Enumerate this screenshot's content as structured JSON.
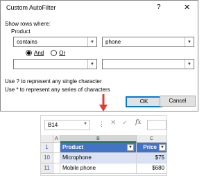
{
  "dialog": {
    "title": "Custom AutoFilter",
    "help_glyph": "?",
    "close_glyph": "✕",
    "show_rows_label": "Show rows where:",
    "field_label": "Product",
    "criteria1": {
      "operator": "contains",
      "value": "phone"
    },
    "criteria2": {
      "operator": "",
      "value": ""
    },
    "logic": {
      "and_label": "And",
      "or_label": "Or",
      "selected": "And"
    },
    "hint_single": "Use ? to represent any single character",
    "hint_series": "Use * to represent any series of characters",
    "ok_label": "OK",
    "cancel_label": "Cancel"
  },
  "arrow": {
    "color": "#e03c31"
  },
  "excel": {
    "name_box": "B14",
    "formula_bar_dots": "⋮",
    "cancel_glyph": "✕",
    "enter_glyph": "✓",
    "fx_label": "fx",
    "formula_value": "",
    "columns": [
      "A",
      "B",
      "C"
    ],
    "header_row": {
      "row": "1",
      "cells": [
        "Product",
        "Price"
      ]
    },
    "rows": [
      {
        "row": "10",
        "product": "Microphone",
        "price": "$75"
      },
      {
        "row": "11",
        "product": "Mobile phone",
        "price": "$680"
      }
    ],
    "table_header_color": "#4472c4",
    "band_color": "#d9e1f2"
  }
}
